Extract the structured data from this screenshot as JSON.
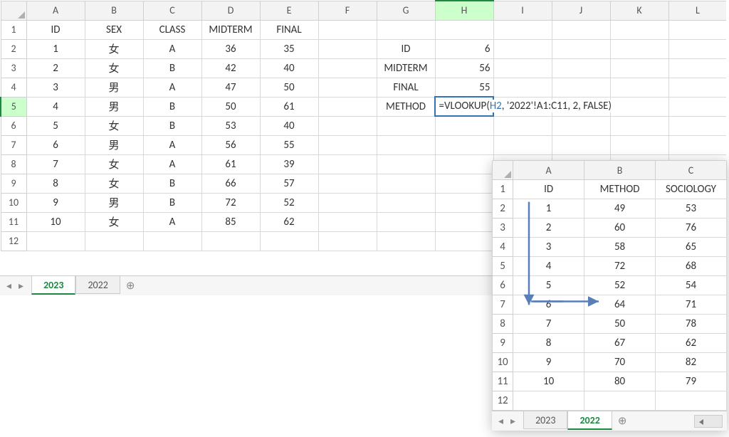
{
  "main_sheet": {
    "columns": [
      "A",
      "B",
      "C",
      "D",
      "E",
      "F",
      "G",
      "H",
      "I",
      "J",
      "K",
      "L"
    ],
    "selected_col": "H",
    "selected_row": 5,
    "headers": [
      "ID",
      "SEX",
      "CLASS",
      "MIDTERM",
      "FINAL"
    ],
    "rows": [
      {
        "id": "1",
        "sex": "女",
        "class": "A",
        "mid": "36",
        "fin": "35"
      },
      {
        "id": "2",
        "sex": "女",
        "class": "B",
        "mid": "42",
        "fin": "40"
      },
      {
        "id": "3",
        "sex": "男",
        "class": "A",
        "mid": "47",
        "fin": "50"
      },
      {
        "id": "4",
        "sex": "男",
        "class": "B",
        "mid": "50",
        "fin": "61"
      },
      {
        "id": "5",
        "sex": "女",
        "class": "B",
        "mid": "53",
        "fin": "40"
      },
      {
        "id": "6",
        "sex": "男",
        "class": "A",
        "mid": "56",
        "fin": "55"
      },
      {
        "id": "7",
        "sex": "女",
        "class": "A",
        "mid": "61",
        "fin": "39"
      },
      {
        "id": "8",
        "sex": "女",
        "class": "B",
        "mid": "66",
        "fin": "57"
      },
      {
        "id": "9",
        "sex": "男",
        "class": "B",
        "mid": "72",
        "fin": "52"
      },
      {
        "id": "10",
        "sex": "女",
        "class": "A",
        "mid": "85",
        "fin": "62"
      }
    ],
    "lookup_labels": {
      "id": "ID",
      "mid": "MIDTERM",
      "fin": "FINAL",
      "method": "METHOD"
    },
    "lookup_values": {
      "id": "6",
      "mid": "56",
      "fin": "55"
    },
    "formula_parts": {
      "pre": "=VLOOKUP(",
      "ref": "H2",
      "post": ", '2022'!A1:C11, 2, FALSE)"
    },
    "tabs": [
      "2023",
      "2022"
    ],
    "active_tab": 0
  },
  "inset_sheet": {
    "columns": [
      "A",
      "B",
      "C"
    ],
    "col_indices": [
      "1",
      "2",
      "3"
    ],
    "headers": [
      "ID",
      "METHOD",
      "SOCIOLOGY"
    ],
    "rows": [
      {
        "id": "1",
        "m": "49",
        "s": "53"
      },
      {
        "id": "2",
        "m": "60",
        "s": "76"
      },
      {
        "id": "3",
        "m": "58",
        "s": "65"
      },
      {
        "id": "4",
        "m": "72",
        "s": "68"
      },
      {
        "id": "5",
        "m": "52",
        "s": "54"
      },
      {
        "id": "6",
        "m": "64",
        "s": "71"
      },
      {
        "id": "7",
        "m": "50",
        "s": "78"
      },
      {
        "id": "8",
        "m": "67",
        "s": "62"
      },
      {
        "id": "9",
        "m": "70",
        "s": "82"
      },
      {
        "id": "10",
        "m": "80",
        "s": "79"
      }
    ],
    "tabs": [
      "2023",
      "2022"
    ],
    "active_tab": 1
  },
  "chart_data": {
    "type": "table",
    "main": {
      "columns": [
        "ID",
        "SEX",
        "CLASS",
        "MIDTERM",
        "FINAL"
      ],
      "data": [
        [
          1,
          "女",
          "A",
          36,
          35
        ],
        [
          2,
          "女",
          "B",
          42,
          40
        ],
        [
          3,
          "男",
          "A",
          47,
          50
        ],
        [
          4,
          "男",
          "B",
          50,
          61
        ],
        [
          5,
          "女",
          "B",
          53,
          40
        ],
        [
          6,
          "男",
          "A",
          56,
          55
        ],
        [
          7,
          "女",
          "A",
          61,
          39
        ],
        [
          8,
          "女",
          "B",
          66,
          57
        ],
        [
          9,
          "男",
          "B",
          72,
          52
        ],
        [
          10,
          "女",
          "A",
          85,
          62
        ]
      ],
      "lookup_block": {
        "ID": 6,
        "MIDTERM": 56,
        "FINAL": 55,
        "METHOD_formula": "=VLOOKUP(H2, '2022'!A1:C11, 2, FALSE)"
      }
    },
    "inset_2022": {
      "columns": [
        "ID",
        "METHOD",
        "SOCIOLOGY"
      ],
      "data": [
        [
          1,
          49,
          53
        ],
        [
          2,
          60,
          76
        ],
        [
          3,
          58,
          65
        ],
        [
          4,
          72,
          68
        ],
        [
          5,
          52,
          54
        ],
        [
          6,
          64,
          71
        ],
        [
          7,
          50,
          78
        ],
        [
          8,
          67,
          62
        ],
        [
          9,
          70,
          82
        ],
        [
          10,
          80,
          79
        ]
      ]
    }
  }
}
